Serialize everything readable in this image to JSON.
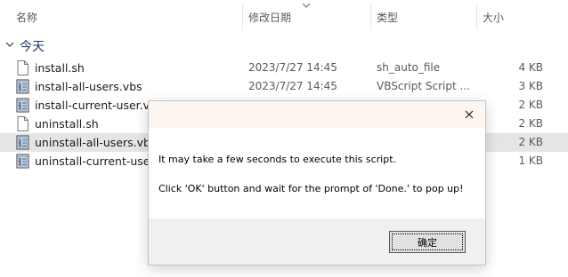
{
  "columns": {
    "name": "名称",
    "date": "修改日期",
    "type": "类型",
    "size": "大小"
  },
  "group": {
    "label": "今天"
  },
  "files": [
    {
      "name": "install.sh",
      "date": "2023/7/27 14:45",
      "type": "sh_auto_file",
      "size": "4 KB",
      "icon": "file-icon",
      "selected": false
    },
    {
      "name": "install-all-users.vbs",
      "date": "2023/7/27 14:45",
      "type": "VBScript Script ...",
      "size": "3 KB",
      "icon": "vbs-script-icon",
      "selected": false
    },
    {
      "name": "install-current-user.vbs",
      "date": "",
      "type": "",
      "size": "2 KB",
      "icon": "vbs-script-icon",
      "selected": false
    },
    {
      "name": "uninstall.sh",
      "date": "",
      "type": "",
      "size": "2 KB",
      "icon": "file-icon",
      "selected": false
    },
    {
      "name": "uninstall-all-users.vbs",
      "date": "",
      "type": "",
      "size": "2 KB",
      "icon": "vbs-script-icon",
      "selected": true
    },
    {
      "name": "uninstall-current-user.",
      "date": "",
      "type": "",
      "size": "1 KB",
      "icon": "vbs-script-icon",
      "selected": false
    }
  ],
  "dialog": {
    "message_line1": "It may take a few seconds to execute this script.",
    "message_line2": "Click 'OK' button and wait for the prompt of 'Done.' to pop up!",
    "ok_label": "确定",
    "close_icon": "close-icon"
  }
}
